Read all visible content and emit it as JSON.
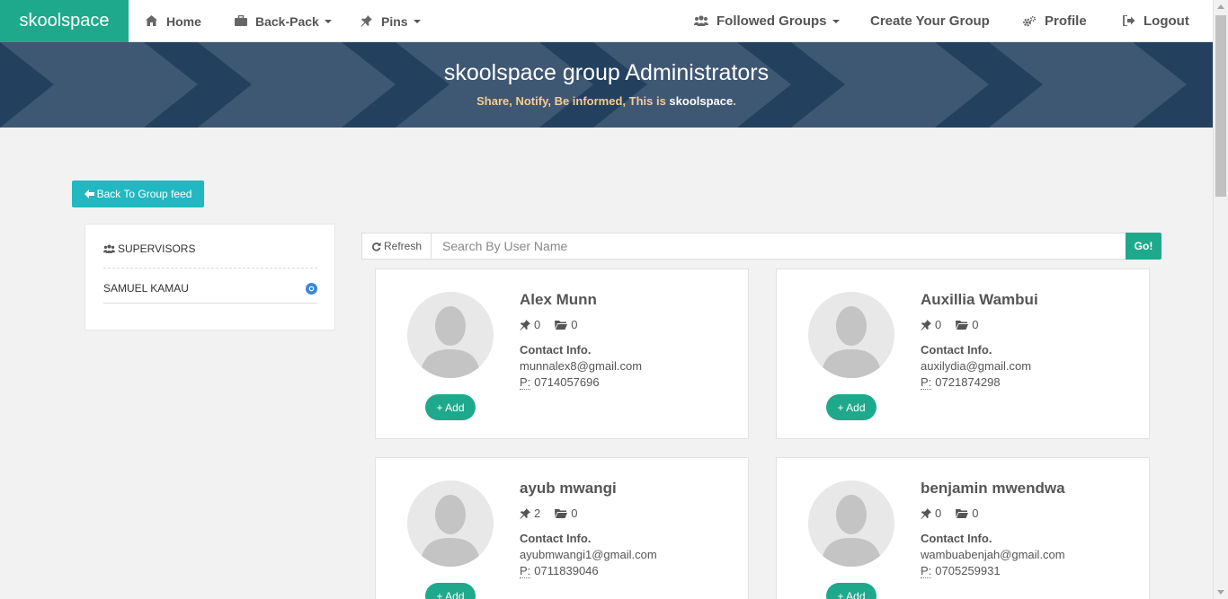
{
  "navbar": {
    "brand": "skoolspace",
    "home": "Home",
    "backpack": "Back-Pack",
    "pins": "Pins",
    "followed_groups": "Followed Groups",
    "create_group": "Create Your Group",
    "profile": "Profile",
    "logout": "Logout"
  },
  "banner": {
    "title": "skoolspace group Administrators",
    "subtitle_prefix": "Share, Notify, Be informed, This is ",
    "subtitle_brand": "skoolspace",
    "subtitle_suffix": "."
  },
  "back_button": "Back To Group feed",
  "supervisors": {
    "heading": "SUPERVISORS",
    "names": [
      "SAMUEL KAMAU"
    ]
  },
  "search": {
    "refresh_label": "Refresh",
    "placeholder": "Search By User Name",
    "go_label": "Go!"
  },
  "contact_label": "Contact Info.",
  "phone_prefix": "P:",
  "add_label": "+ Add",
  "users": [
    {
      "name": "Alex Munn",
      "pins": "0",
      "folders": "0",
      "email": "munnalex8@gmail.com",
      "phone": "0714057696"
    },
    {
      "name": "Auxillia Wambui",
      "pins": "0",
      "folders": "0",
      "email": "auxilydia@gmail.com",
      "phone": "0721874298"
    },
    {
      "name": "ayub mwangi",
      "pins": "2",
      "folders": "0",
      "email": "ayubmwangi1@gmail.com",
      "phone": "0711839046"
    },
    {
      "name": "benjamin mwendwa",
      "pins": "0",
      "folders": "0",
      "email": "wambuabenjah@gmail.com",
      "phone": "0705259931"
    }
  ],
  "colors": {
    "brand": "#1fa98c",
    "banner": "#23405f",
    "back_button": "#22b8c2",
    "banner_subtitle": "#f5cc91"
  }
}
